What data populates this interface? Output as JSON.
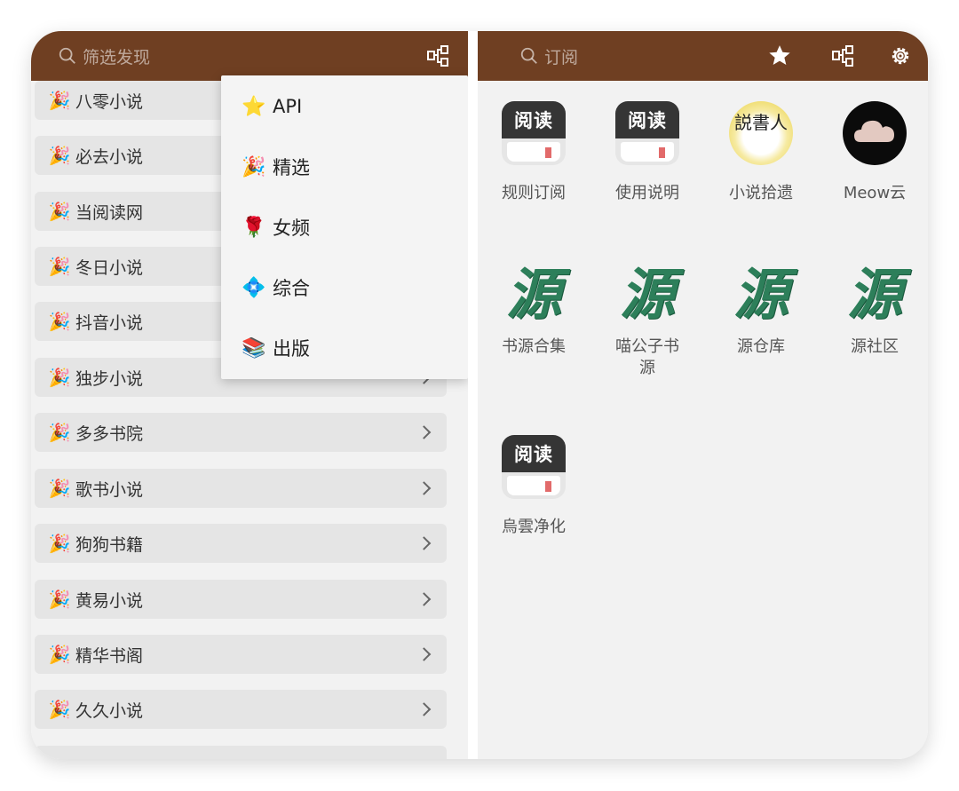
{
  "left": {
    "search_placeholder": "筛选发现",
    "rows": [
      {
        "label": "八零小说",
        "emoji": "🎉"
      },
      {
        "label": "必去小说",
        "emoji": "🎉"
      },
      {
        "label": "当阅读网",
        "emoji": "🎉"
      },
      {
        "label": "冬日小说",
        "emoji": "🎉"
      },
      {
        "label": "抖音小说",
        "emoji": "🎉"
      },
      {
        "label": "独步小说",
        "emoji": "🎉"
      },
      {
        "label": "多多书院",
        "emoji": "🎉"
      },
      {
        "label": "歌书小说",
        "emoji": "🎉"
      },
      {
        "label": "狗狗书籍",
        "emoji": "🎉"
      },
      {
        "label": "黄易小说",
        "emoji": "🎉"
      },
      {
        "label": "精华书阁",
        "emoji": "🎉"
      },
      {
        "label": "久久小说",
        "emoji": "🎉"
      }
    ],
    "dropdown": [
      {
        "label": "API",
        "emoji": "⭐"
      },
      {
        "label": "精选",
        "emoji": "🎉"
      },
      {
        "label": "女频",
        "emoji": "🌹"
      },
      {
        "label": "综合",
        "emoji": "💠"
      },
      {
        "label": "出版",
        "emoji": "📚"
      }
    ]
  },
  "right": {
    "search_placeholder": "订阅",
    "icons": [
      "star-icon",
      "group-icon",
      "gear-icon"
    ],
    "items": [
      {
        "name": "规则订阅",
        "icon": "yuedu-app-icon",
        "icon_text": "阅读"
      },
      {
        "name": "使用说明",
        "icon": "yuedu-app-icon",
        "icon_text": "阅读"
      },
      {
        "name": "小说拾遗",
        "icon": "shuohua-logo-icon",
        "icon_text": "説書人"
      },
      {
        "name": "Meow云",
        "icon": "cloud-icon"
      },
      {
        "name": "书源合集",
        "icon": "yuan-logo-icon",
        "icon_text": "源"
      },
      {
        "name": "喵公子书源",
        "icon": "yuan-logo-icon",
        "icon_text": "源"
      },
      {
        "name": "源仓库",
        "icon": "yuan-logo-icon",
        "icon_text": "源"
      },
      {
        "name": "源社区",
        "icon": "yuan-logo-icon",
        "icon_text": "源"
      },
      {
        "name": "烏雲净化",
        "icon": "yuedu-app-icon",
        "icon_text": "阅读"
      }
    ]
  },
  "colors": {
    "toolbar": "#6f3f22",
    "background": "#f2f2f2",
    "row": "#e5e5e5",
    "accent_green": "#2d7f5a"
  }
}
